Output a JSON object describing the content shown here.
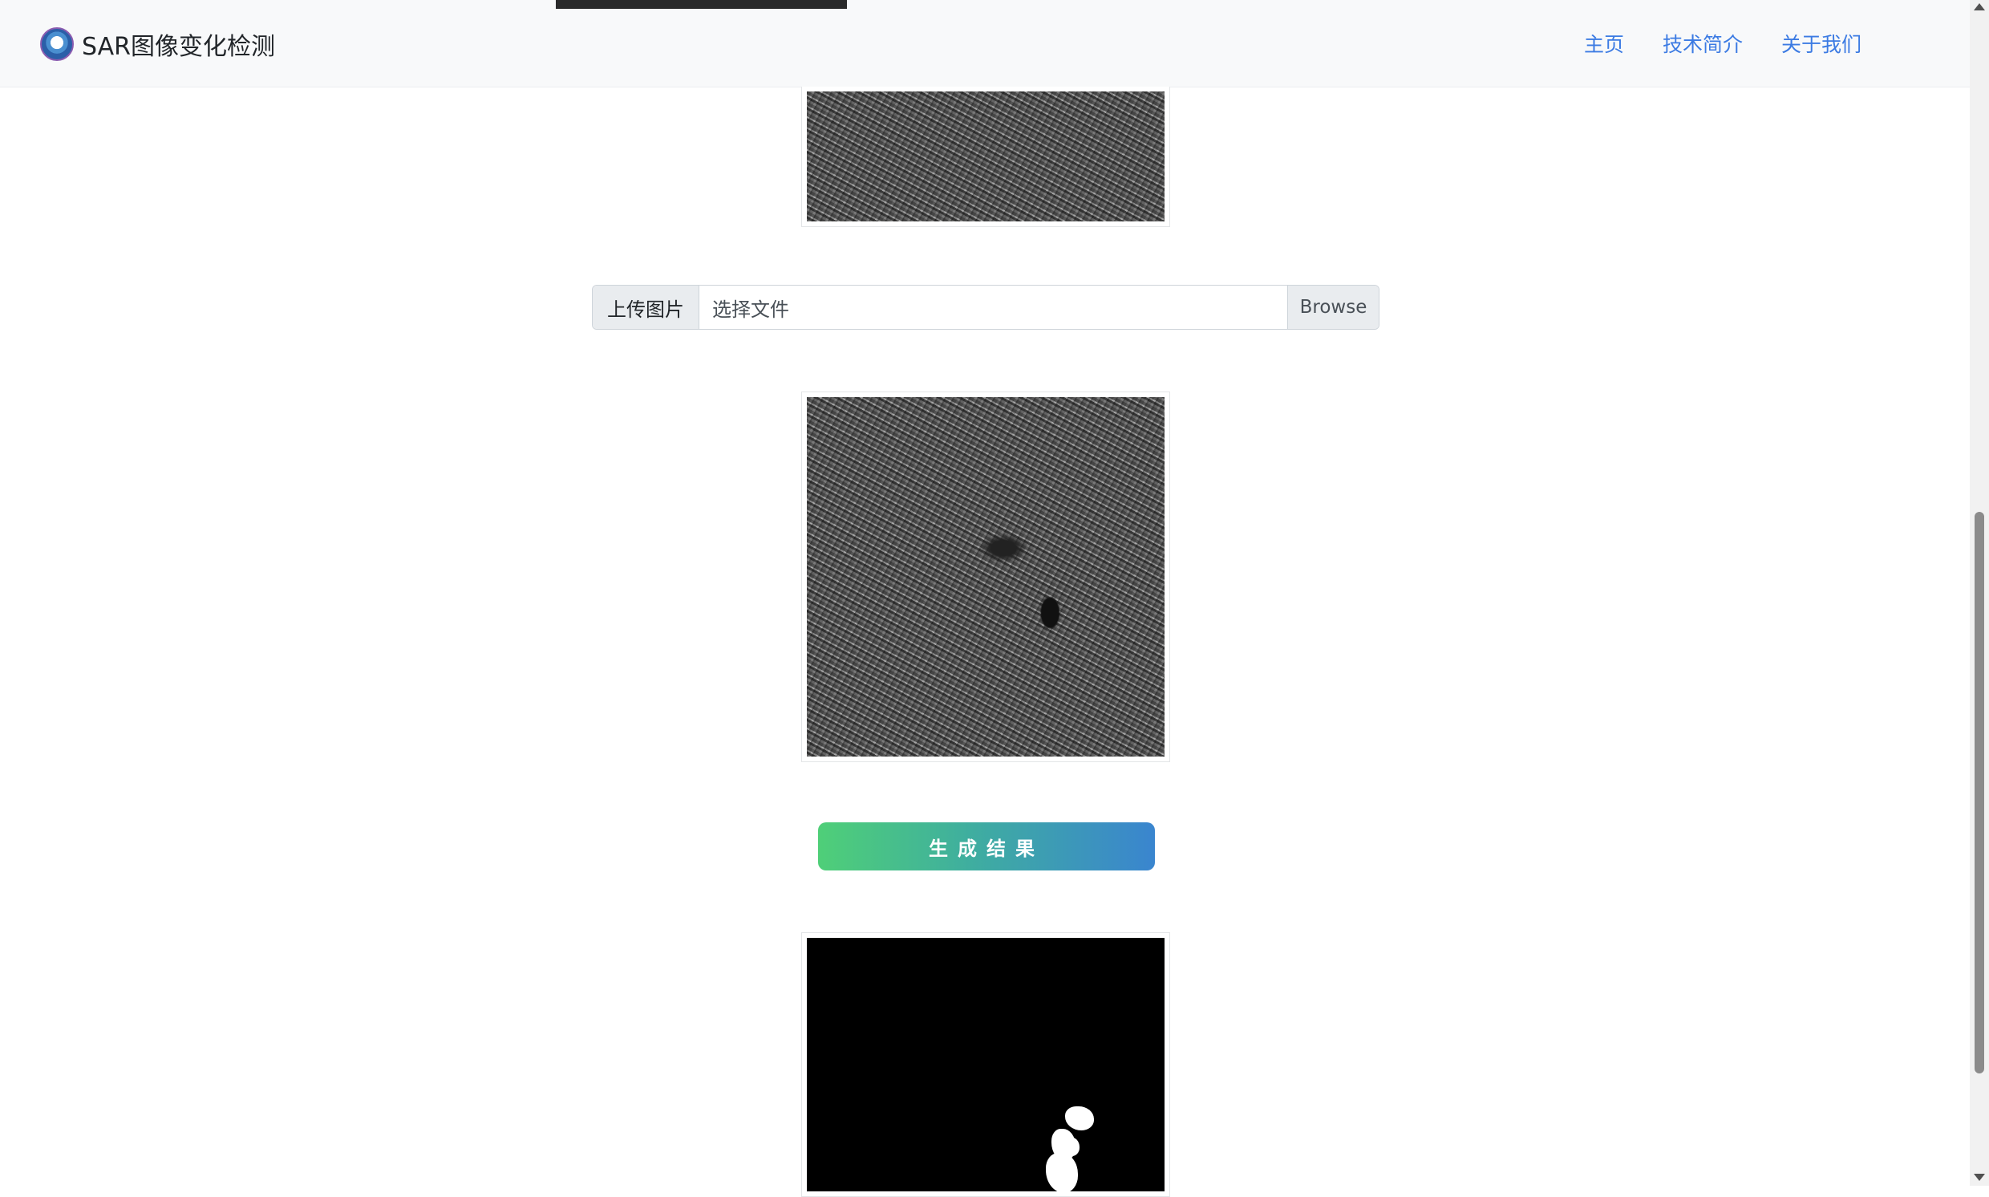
{
  "navbar": {
    "brand": "SAR图像变化检测",
    "links": [
      "主页",
      "技术简介",
      "关于我们"
    ]
  },
  "upload": {
    "label": "上传图片",
    "placeholder": "选择文件",
    "browse": "Browse"
  },
  "actions": {
    "generate": "生成结果"
  },
  "colors": {
    "nav_link": "#3c7be3",
    "button_gradient_start": "#4fcf78",
    "button_gradient_end": "#3a85cf",
    "navbar_bg": "#f8f9fa"
  },
  "icons": [
    "university-logo-icon"
  ]
}
